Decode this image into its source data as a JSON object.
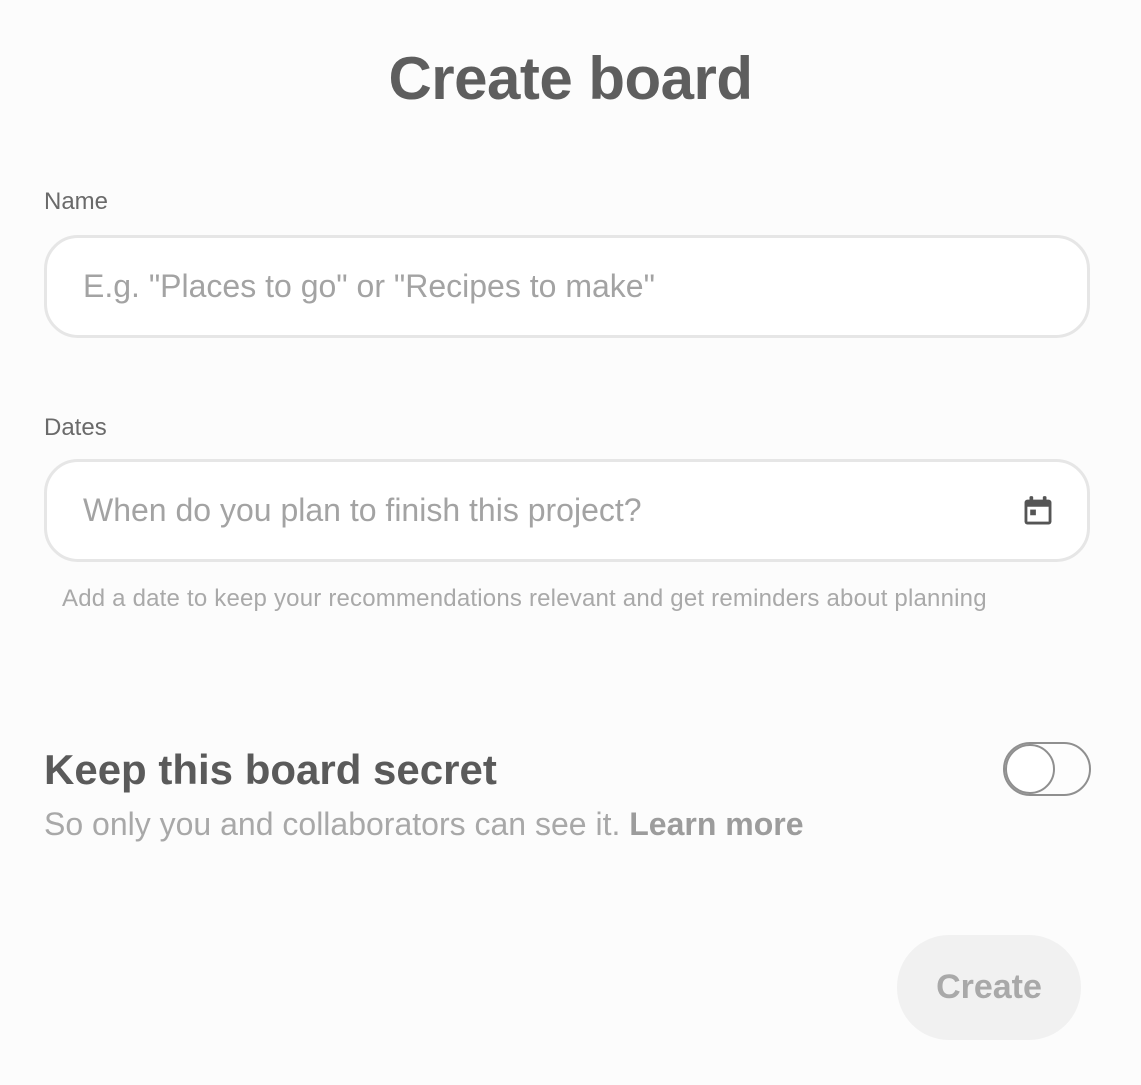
{
  "dialog": {
    "title": "Create board"
  },
  "name_field": {
    "label": "Name",
    "value": "",
    "placeholder": "E.g. \"Places to go\" or \"Recipes to make\""
  },
  "dates_field": {
    "label": "Dates",
    "value": "",
    "placeholder": "When do you plan to finish this project?",
    "icon": "calendar-icon",
    "helper": "Add a date to keep your recommendations relevant and get reminders about planning"
  },
  "secret": {
    "title": "Keep this board secret",
    "description": "So only you and collaborators can see it.",
    "learn_more": "Learn more",
    "enabled": false
  },
  "actions": {
    "create_label": "Create",
    "create_disabled": true
  },
  "colors": {
    "background": "#fcfcfc",
    "text_primary": "#5e5e5e",
    "text_muted": "#a8a8a8",
    "field_border": "#e6e6e6",
    "button_disabled_bg": "#f1f1f1"
  }
}
